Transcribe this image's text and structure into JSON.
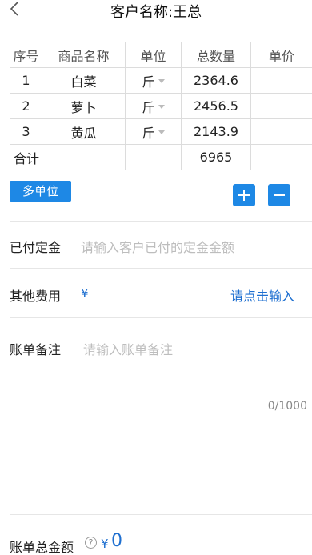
{
  "header": {
    "back_icon": "chevron-left-icon",
    "title": "客户名称:王总"
  },
  "table": {
    "columns": [
      "序号",
      "商品名称",
      "单位",
      "总数量",
      "单价"
    ],
    "rows": [
      {
        "index": "1",
        "name": "白菜",
        "unit": "斤",
        "qty": "2364.6",
        "price": ""
      },
      {
        "index": "2",
        "name": "萝卜",
        "unit": "斤",
        "qty": "2456.5",
        "price": ""
      },
      {
        "index": "3",
        "name": "黄瓜",
        "unit": "斤",
        "qty": "2143.9",
        "price": ""
      }
    ],
    "total_row": {
      "label": "合计",
      "qty": "6965"
    }
  },
  "actions": {
    "multi_unit_label": "多单位",
    "add_icon": "plus-icon",
    "remove_icon": "minus-icon"
  },
  "deposit": {
    "label": "已付定金",
    "placeholder": "请输入客户已付的定金金额"
  },
  "other_fees": {
    "label": "其他费用",
    "currency": "¥",
    "link_text": "请点击输入"
  },
  "remarks": {
    "label": "账单备注",
    "placeholder": "请输入账单备注",
    "counter": "0/1000"
  },
  "footer": {
    "total_label": "账单总金额",
    "help_icon": "question-circle-icon",
    "currency": "¥",
    "total_value": "0"
  },
  "colors": {
    "accent": "#1e88e5",
    "link": "#1e6fd0",
    "placeholder": "#bdbdbd",
    "border": "#dcdcdc"
  }
}
